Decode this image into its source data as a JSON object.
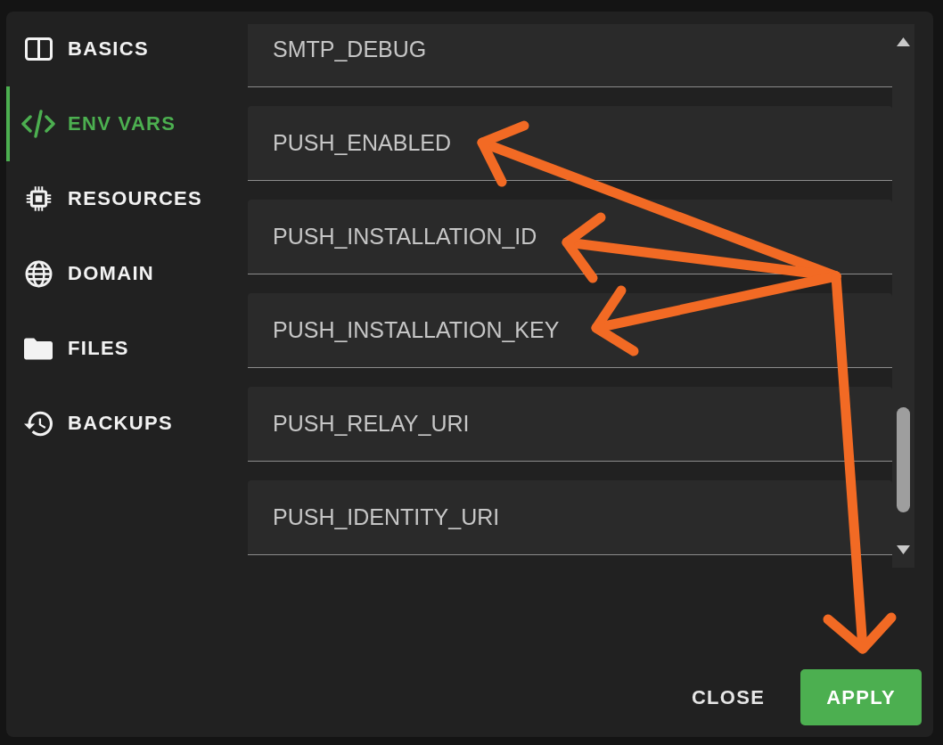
{
  "sidebar": {
    "items": [
      {
        "label": "BASICS",
        "selected": false
      },
      {
        "label": "ENV VARS",
        "selected": true
      },
      {
        "label": "RESOURCES",
        "selected": false
      },
      {
        "label": "DOMAIN",
        "selected": false
      },
      {
        "label": "FILES",
        "selected": false
      },
      {
        "label": "BACKUPS",
        "selected": false
      }
    ]
  },
  "fields": [
    {
      "placeholder": "SMTP_DEBUG"
    },
    {
      "placeholder": "PUSH_ENABLED"
    },
    {
      "placeholder": "PUSH_INSTALLATION_ID"
    },
    {
      "placeholder": "PUSH_INSTALLATION_KEY"
    },
    {
      "placeholder": "PUSH_RELAY_URI"
    },
    {
      "placeholder": "PUSH_IDENTITY_URI"
    }
  ],
  "buttons": [
    {
      "label": "CLOSE",
      "kind": "text"
    },
    {
      "label": "APPLY",
      "kind": "primary"
    }
  ],
  "annotations": [
    {
      "kind": "arrow"
    },
    {
      "kind": "arrow"
    },
    {
      "kind": "arrow"
    },
    {
      "kind": "arrow"
    }
  ]
}
